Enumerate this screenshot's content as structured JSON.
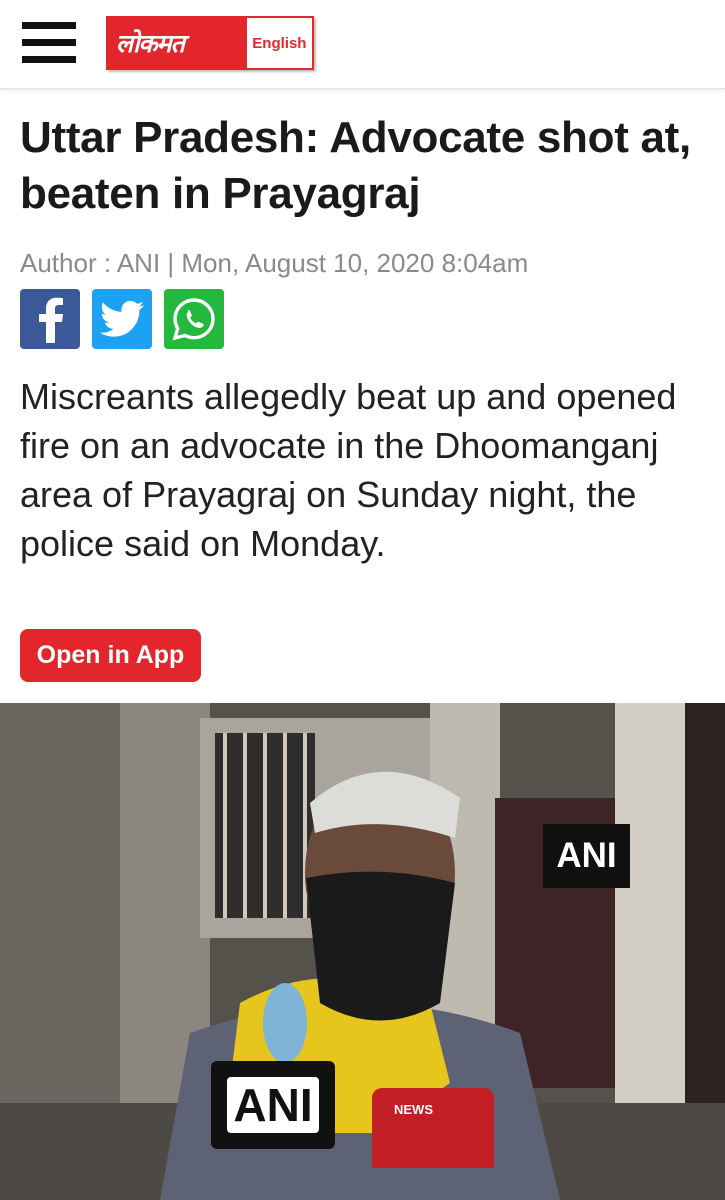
{
  "header": {
    "menu_icon": "hamburger-menu-icon",
    "logo_text": "लोकमत",
    "logo_edition": "English"
  },
  "article": {
    "headline": "Uttar Pradesh: Advocate shot at, beaten in Prayagraj",
    "meta": "Author : ANI | Mon, August 10, 2020 8:04am",
    "summary": "Miscreants allegedly beat up and opened fire on an advocate in the Dhoomanganj area of Prayagraj on Sunday night, the police said on Monday.",
    "open_in_app_label": "Open in App"
  },
  "share": {
    "facebook_icon": "facebook-icon",
    "twitter_icon": "twitter-icon",
    "whatsapp_icon": "whatsapp-icon"
  },
  "photo": {
    "watermark": "ANI",
    "mic_label_ani": "ANI",
    "mic_label_news": "NEWS"
  },
  "colors": {
    "brand_red": "#e3262b",
    "facebook": "#3b5998",
    "twitter": "#1da1f2",
    "whatsapp": "#25b83f"
  }
}
